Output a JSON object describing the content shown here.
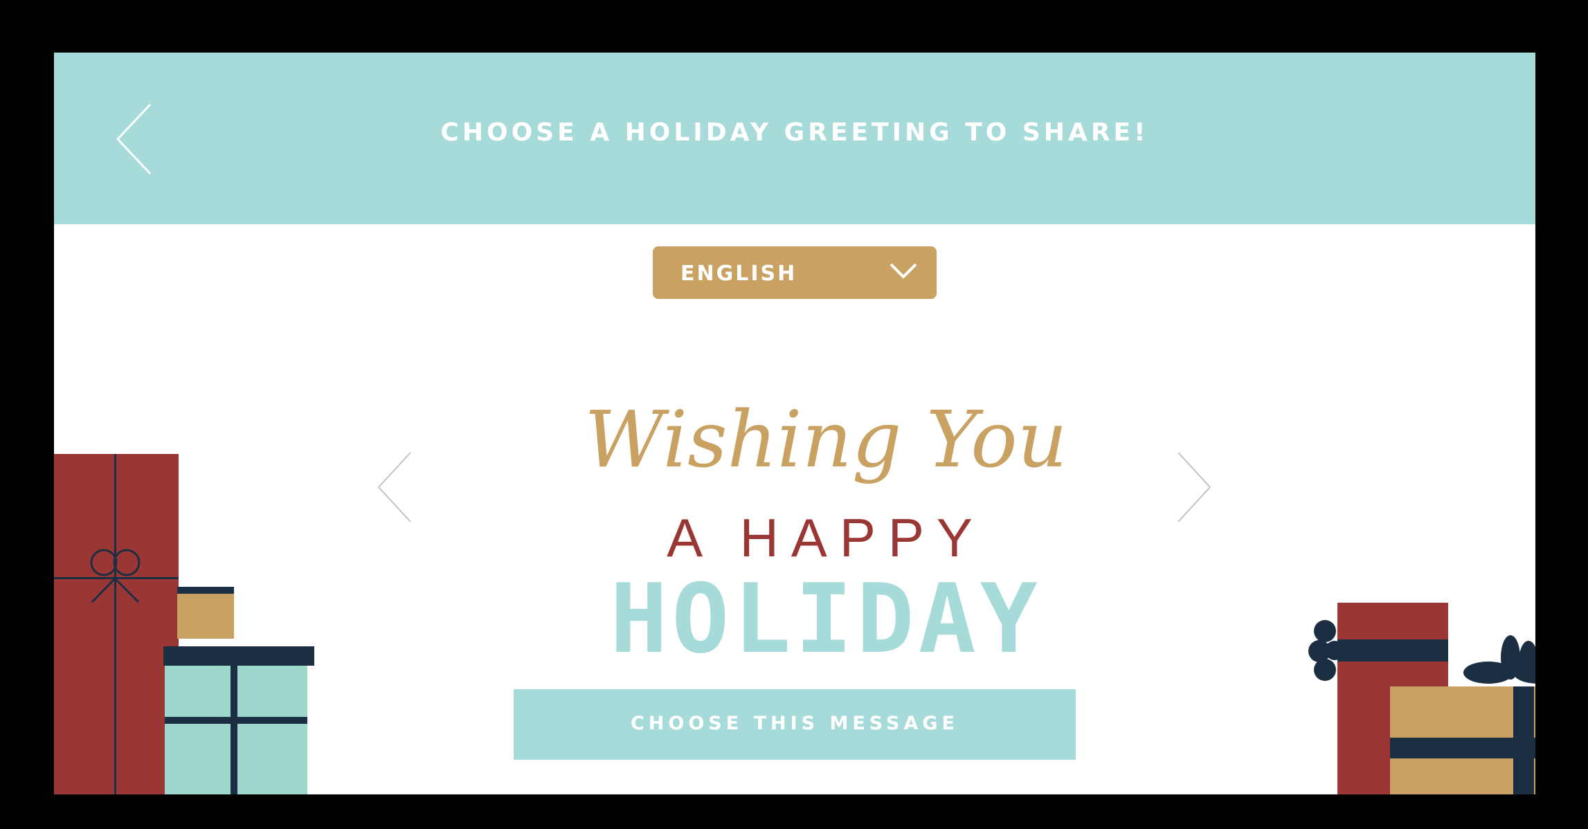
{
  "header": {
    "title": "CHOOSE A HOLIDAY GREETING TO SHARE!",
    "back_icon": "chevron-left-icon"
  },
  "language_select": {
    "selected": "ENGLISH",
    "icon": "chevron-down-icon"
  },
  "greeting": {
    "line1": "Wishing You",
    "line2": "A HAPPY",
    "line3": "HOLIDAY"
  },
  "carousel": {
    "prev_icon": "chevron-left-icon",
    "next_icon": "chevron-right-icon"
  },
  "cta": {
    "label": "CHOOSE THIS MESSAGE"
  },
  "colors": {
    "teal": "#a7dbd9",
    "gold": "#c9a263",
    "red": "#9a3634",
    "navy": "#1c2e42",
    "mint": "#9ed8cc"
  }
}
